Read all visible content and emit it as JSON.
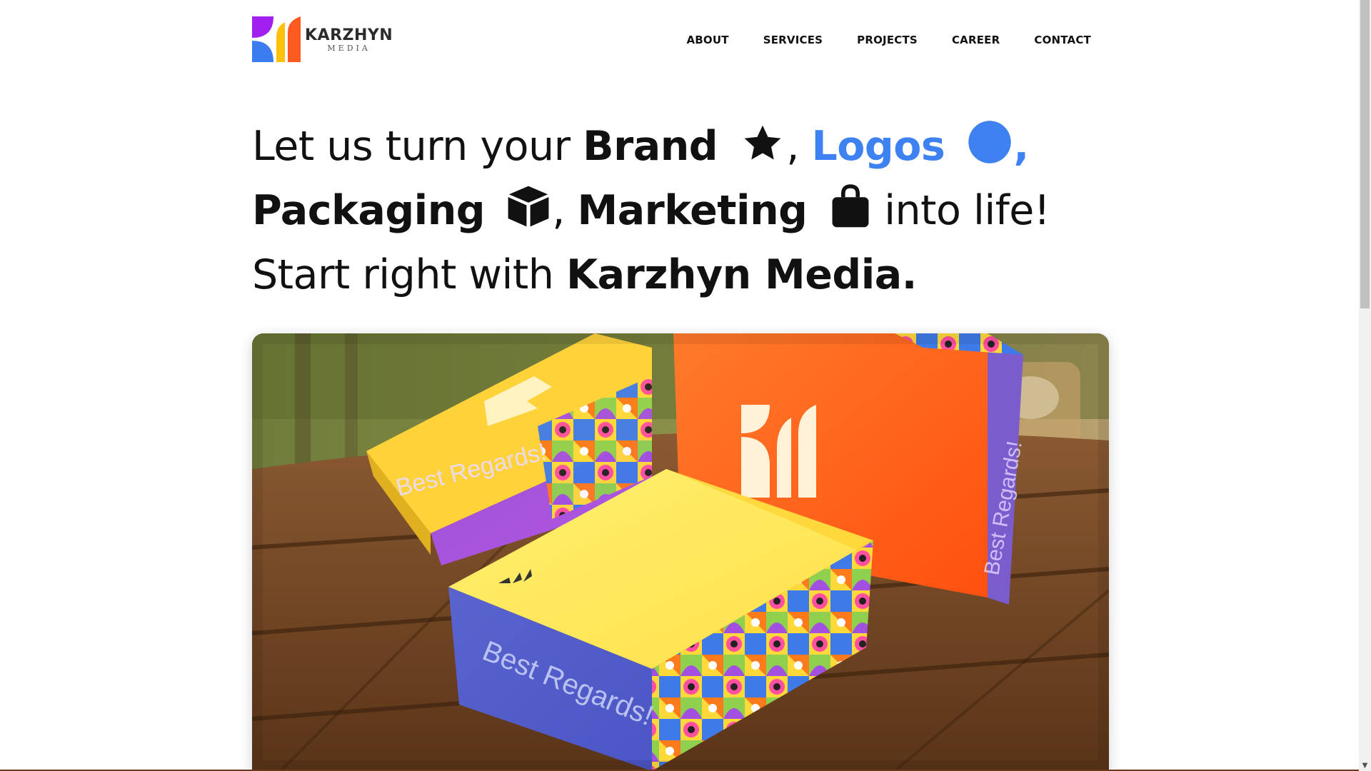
{
  "logo": {
    "name": "KARZHYN",
    "sub": "MEDIA",
    "icon": "karzhyn-logo-icon",
    "colors": {
      "purple": "#a020f0",
      "blue": "#3b7cf0",
      "yellow": "#ffc107",
      "orange": "#ff5a1f"
    }
  },
  "nav": {
    "items": [
      {
        "label": "ABOUT"
      },
      {
        "label": "SERVICES"
      },
      {
        "label": "PROJECTS"
      },
      {
        "label": "CAREER"
      },
      {
        "label": "CONTACT"
      }
    ]
  },
  "hero": {
    "line1": {
      "prefix": "Let us turn your ",
      "brand": "Brand",
      "brand_icon": "star-icon",
      "sep1": ", ",
      "logos": "Logos",
      "logos_icon": "circle-icon",
      "sep2": ","
    },
    "line2": {
      "packaging": "Packaging",
      "packaging_icon": "box-icon",
      "sep": ", ",
      "marketing": "Marketing",
      "marketing_icon": "shopping-bag-icon",
      "suffix": " into life!"
    },
    "line3": {
      "prefix": "Start right with ",
      "company": "Karzhyn Media."
    },
    "accent_color": "#3d82f0"
  },
  "image": {
    "box_text_1": "Best Regards!",
    "box_text_2": "Best Regards!",
    "box_text_3": "Best Regards!"
  }
}
